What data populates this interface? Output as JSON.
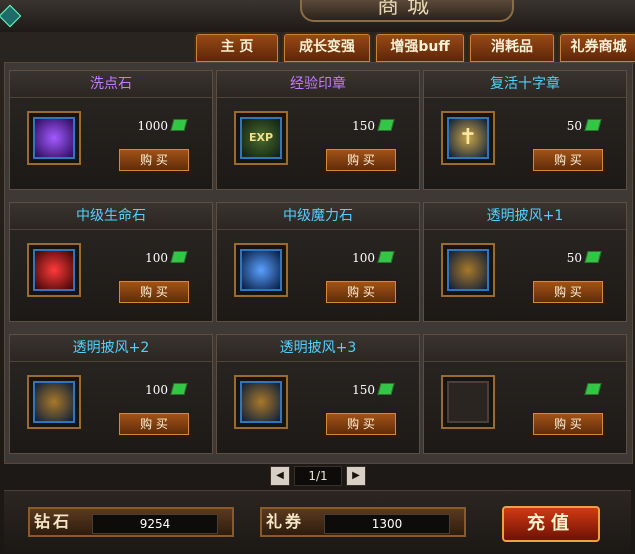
{
  "header": {
    "title": "商城"
  },
  "tabs": [
    {
      "label": "主 页"
    },
    {
      "label": "成长变强"
    },
    {
      "label": "增强buff"
    },
    {
      "label": "消耗品"
    },
    {
      "label": "礼券商城"
    }
  ],
  "items": [
    {
      "name": "洗点石",
      "price": "1000",
      "icon": "blue-crystal-icon",
      "name_color": "#c37bff"
    },
    {
      "name": "经验印章",
      "price": "150",
      "icon": "exp-stamp-icon",
      "name_color": "#c37bff"
    },
    {
      "name": "复活十字章",
      "price": "50",
      "icon": "golden-cross-icon",
      "name_color": "#4fd1ff"
    },
    {
      "name": "中级生命石",
      "price": "100",
      "icon": "red-gem-icon",
      "name_color": "#4fd1ff"
    },
    {
      "name": "中级魔力石",
      "price": "100",
      "icon": "blue-gem-icon",
      "name_color": "#4fd1ff"
    },
    {
      "name": "透明披风+1",
      "price": "50",
      "icon": "cloak-icon",
      "name_color": "#4fd1ff"
    },
    {
      "name": "透明披风+2",
      "price": "100",
      "icon": "cloak-icon",
      "name_color": "#4fd1ff"
    },
    {
      "name": "透明披风+3",
      "price": "150",
      "icon": "cloak-icon",
      "name_color": "#4fd1ff"
    },
    {
      "name": "",
      "price": "",
      "icon": "empty-slot",
      "name_color": "#4fd1ff"
    }
  ],
  "buy_label": "购 买",
  "pager": {
    "current": "1/1",
    "prev": "◀",
    "next": "▶"
  },
  "bottom": {
    "diamond_label": "钻石",
    "diamond_value": "9254",
    "coupon_label": "礼券",
    "coupon_value": "1300",
    "recharge_label": "充值"
  }
}
